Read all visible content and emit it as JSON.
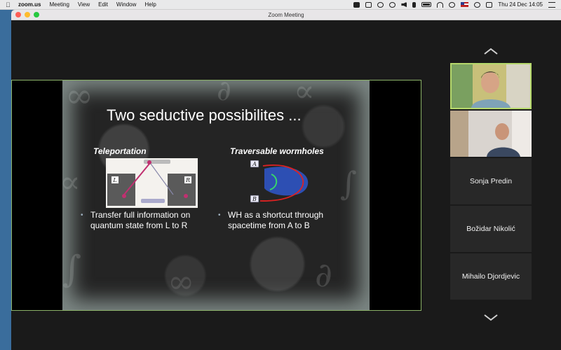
{
  "menubar": {
    "app": "zoom.us",
    "items": [
      "Meeting",
      "View",
      "Edit",
      "Window",
      "Help"
    ],
    "datetime": "Thu 24 Dec  14:05"
  },
  "window": {
    "title": "Zoom Meeting"
  },
  "slide": {
    "title": "Two seductive possibilites ...",
    "left": {
      "heading": "Teleportation",
      "labels": {
        "l": "L",
        "r": "R"
      },
      "bullet": [
        "Transfer full information on",
        "quantum state from L to R"
      ]
    },
    "right": {
      "heading": "Traversable wormholes",
      "labels": {
        "a": "A",
        "b": "B"
      },
      "bullet": [
        "WH as a shortcut through",
        "spacetime from A to B"
      ]
    }
  },
  "participants": [
    {
      "name": "Sonja Predin"
    },
    {
      "name": "Božidar Nikolić"
    },
    {
      "name": "Mihailo Djordjevic"
    }
  ],
  "colors": {
    "active_border": "#b5d86b",
    "share_border": "#8cb369"
  }
}
